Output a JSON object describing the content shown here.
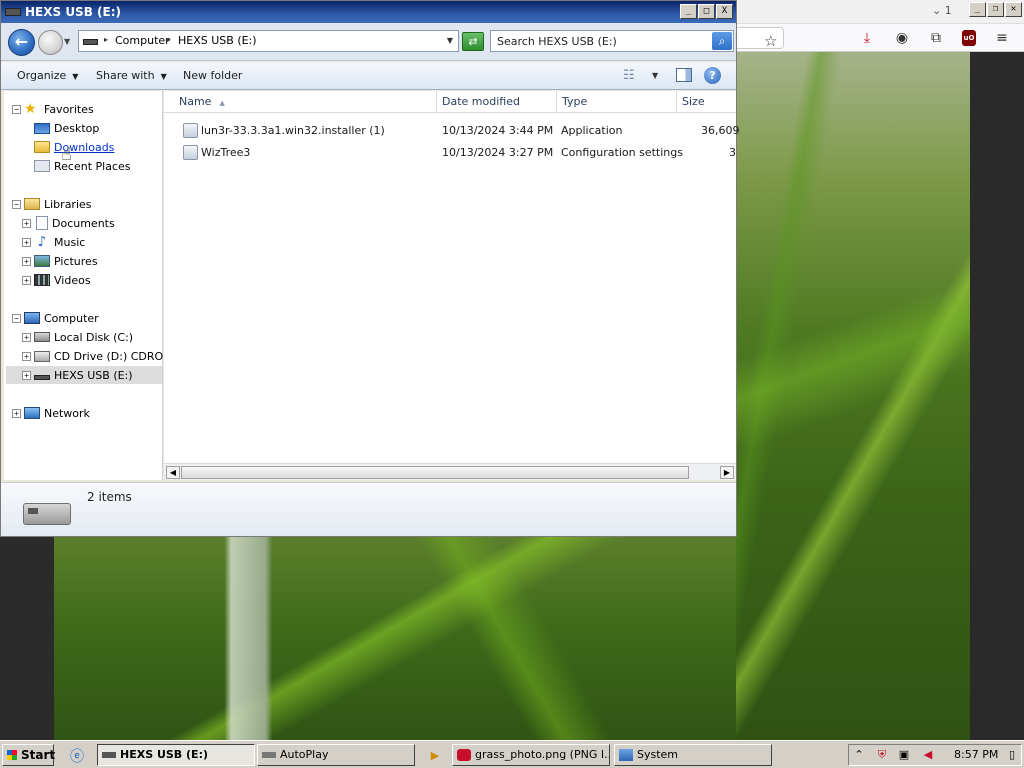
{
  "window": {
    "title": "HEXS USB (E:)",
    "controls": {
      "minimize": "_",
      "maximize": "□",
      "close": "X"
    }
  },
  "navigation": {
    "back_symbol": "←",
    "breadcrumb": [
      "Computer",
      "HEXS USB (E:)"
    ],
    "search_placeholder": "Search HEXS USB (E:)"
  },
  "commands": {
    "organize": "Organize",
    "share_with": "Share with",
    "new_folder": "New folder"
  },
  "navpane": {
    "favorites": {
      "label": "Favorites",
      "items": [
        "Desktop",
        "Downloads",
        "Recent Places"
      ]
    },
    "libraries": {
      "label": "Libraries",
      "items": [
        "Documents",
        "Music",
        "Pictures",
        "Videos"
      ]
    },
    "computer": {
      "label": "Computer",
      "items": [
        "Local Disk (C:)",
        "CD Drive (D:) CDROM",
        "HEXS USB (E:)"
      ]
    },
    "network": {
      "label": "Network"
    },
    "selected": "HEXS USB (E:)"
  },
  "columns": [
    "Name",
    "Date modified",
    "Type",
    "Size"
  ],
  "files": [
    {
      "name": "lun3r-33.3.3a1.win32.installer (1)",
      "date": "10/13/2024 3:44 PM",
      "type": "Application",
      "size": "36,609"
    },
    {
      "name": "WizTree3",
      "date": "10/13/2024 3:27 PM",
      "type": "Configuration settings",
      "size": "3"
    }
  ],
  "details": {
    "item_count": "2 items"
  },
  "browser": {
    "tab_count": "1"
  },
  "taskbar": {
    "start": "Start",
    "tasks": [
      "HEXS USB (E:)",
      "AutoPlay",
      "grass_photo.png (PNG I...",
      "System"
    ],
    "active_task": "HEXS USB (E:)",
    "clock": "8:57 PM"
  }
}
